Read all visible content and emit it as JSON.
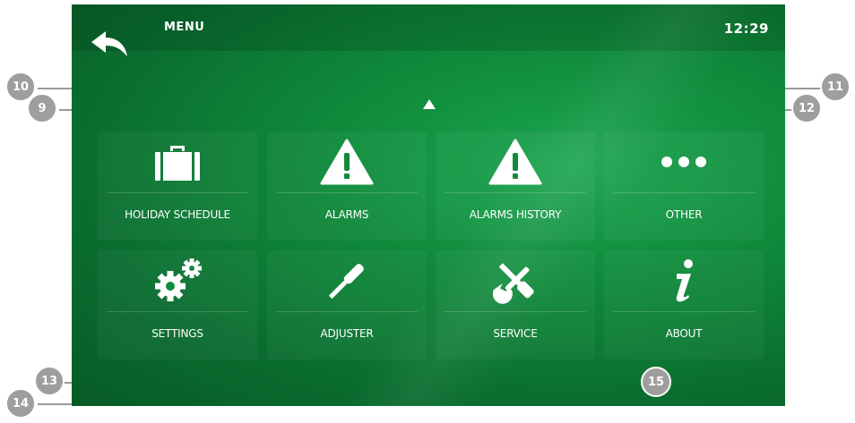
{
  "header": {
    "title": "MENU",
    "time": "12:29"
  },
  "tiles": [
    {
      "label": "HOLIDAY SCHEDULE",
      "icon": "briefcase-icon"
    },
    {
      "label": "ALARMS",
      "icon": "warning-icon"
    },
    {
      "label": "ALARMS HISTORY",
      "icon": "warning-icon"
    },
    {
      "label": "OTHER",
      "icon": "more-dots-icon"
    },
    {
      "label": "SETTINGS",
      "icon": "gears-icon"
    },
    {
      "label": "ADJUSTER",
      "icon": "screwdriver-icon"
    },
    {
      "label": "SERVICE",
      "icon": "wrench-screwdriver-icon"
    },
    {
      "label": "ABOUT",
      "icon": "info-icon"
    }
  ],
  "callouts": [
    "9",
    "10",
    "11",
    "12",
    "13",
    "14",
    "15"
  ],
  "colors": {
    "screen_bg": "#0f8a3b",
    "badge": "#9e9e9e"
  }
}
